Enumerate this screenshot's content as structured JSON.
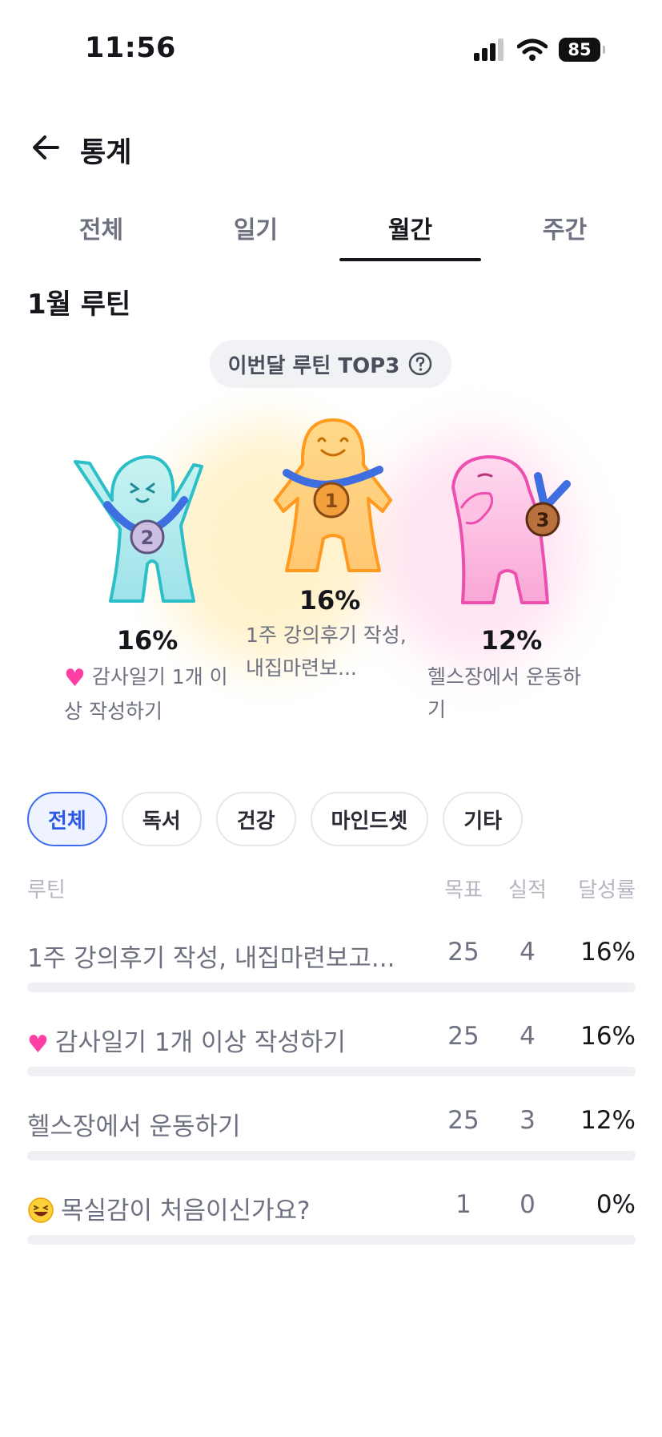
{
  "status_bar": {
    "time": "11:56",
    "battery": "85"
  },
  "header": {
    "title": "통계"
  },
  "tabs": [
    {
      "label": "전체",
      "active": false
    },
    {
      "label": "일기",
      "active": false
    },
    {
      "label": "월간",
      "active": true
    },
    {
      "label": "주간",
      "active": false
    }
  ],
  "section_title": "1월 루틴",
  "top3": {
    "label": "이번달 루틴 TOP3",
    "first": {
      "rank": "1",
      "percent": "16%",
      "name": "1주 강의후기 작성, 내집마련보...",
      "color": "#ffb13b"
    },
    "second": {
      "rank": "2",
      "percent": "16%",
      "name": "감사일기 1개 이상 작성하기",
      "color": "#5dd3d8"
    },
    "third": {
      "rank": "3",
      "percent": "12%",
      "name": "헬스장에서 운동하기",
      "color": "#f57cc8"
    }
  },
  "chips": [
    {
      "label": "전체",
      "active": true
    },
    {
      "label": "독서",
      "active": false
    },
    {
      "label": "건강",
      "active": false
    },
    {
      "label": "마인드셋",
      "active": false
    },
    {
      "label": "기타",
      "active": false
    }
  ],
  "table": {
    "headers": {
      "name": "루틴",
      "goal": "목표",
      "done": "실적",
      "rate": "달성률"
    },
    "rows": [
      {
        "emoji": "",
        "name": "1주 강의후기 작성, 내집마련보고...",
        "goal": "25",
        "done": "4",
        "rate": "16%",
        "progress": 0.16
      },
      {
        "emoji": "heart",
        "name": "감사일기 1개 이상 작성하기",
        "goal": "25",
        "done": "4",
        "rate": "16%",
        "progress": 0.16
      },
      {
        "emoji": "",
        "name": "헬스장에서 운동하기",
        "goal": "25",
        "done": "3",
        "rate": "12%",
        "progress": 0.12
      },
      {
        "emoji": "laughing-face",
        "name": "목실감이 처음이신가요?",
        "goal": "1",
        "done": "0",
        "rate": "0%",
        "progress": 0
      }
    ]
  },
  "colors": {
    "accent": "#3d6cf0",
    "text": "#16171d",
    "muted": "#6d7180"
  }
}
